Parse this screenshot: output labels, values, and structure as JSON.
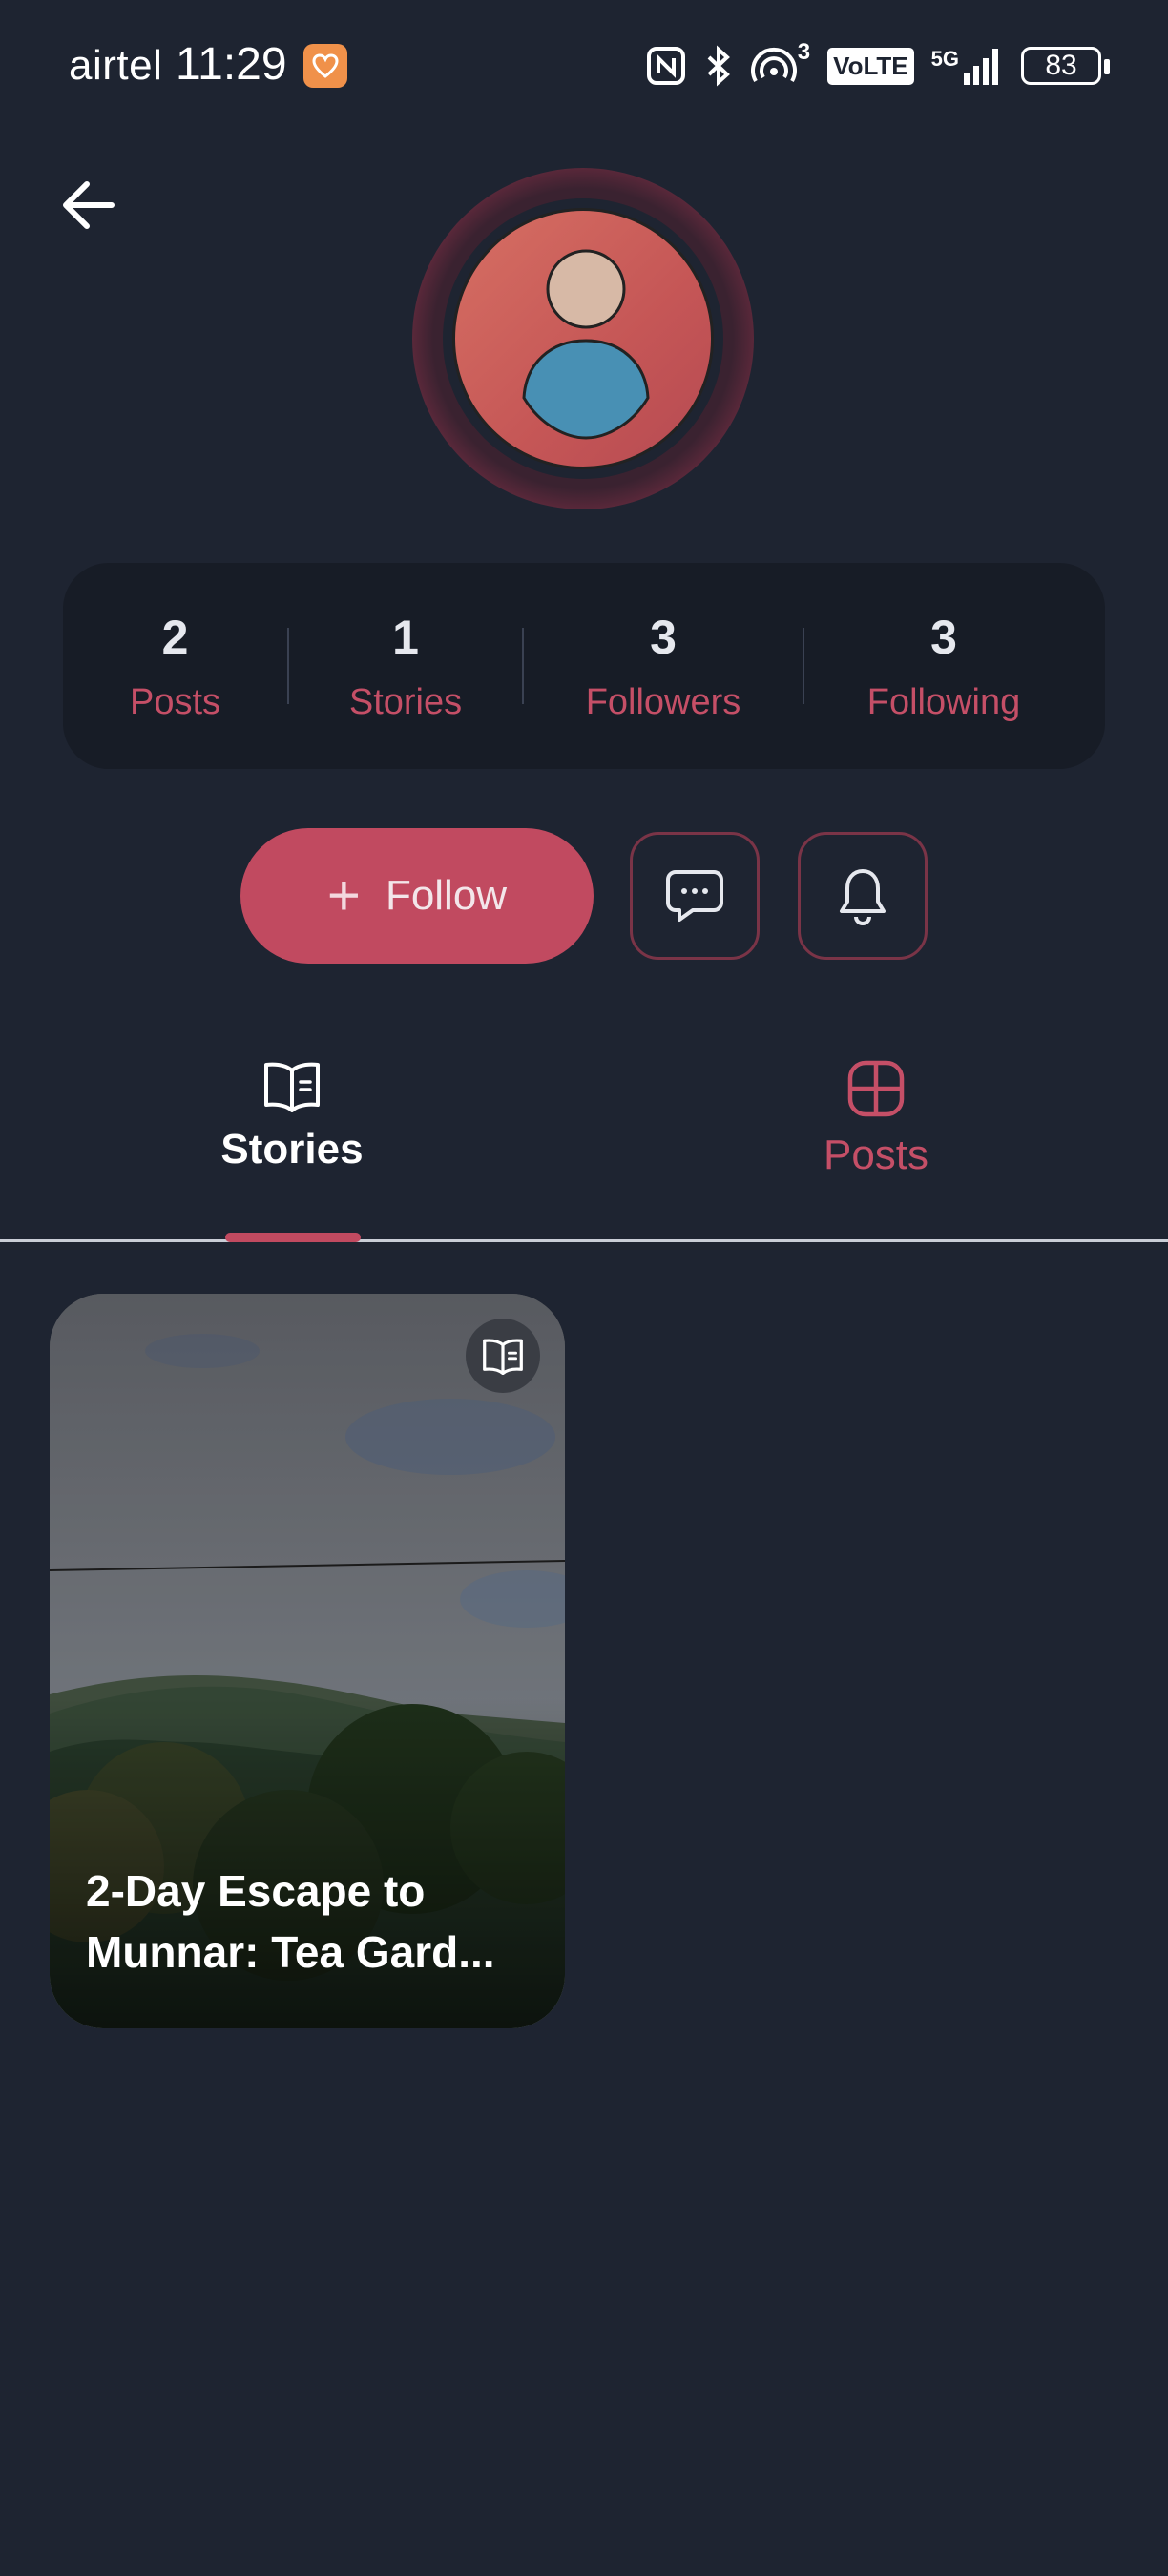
{
  "status_bar": {
    "carrier": "airtel",
    "time": "11:29",
    "network_superscript": "3",
    "volte": "VoLTE",
    "network_type": "5G",
    "battery": "83"
  },
  "profile": {
    "stats": [
      {
        "value": "2",
        "label": "Posts"
      },
      {
        "value": "1",
        "label": "Stories"
      },
      {
        "value": "3",
        "label": "Followers"
      },
      {
        "value": "3",
        "label": "Following"
      }
    ]
  },
  "actions": {
    "follow_plus": "+",
    "follow_label": "Follow"
  },
  "tabs": [
    {
      "label": "Stories",
      "icon": "book-open-icon",
      "active": true
    },
    {
      "label": "Posts",
      "icon": "grid-icon",
      "active": false
    }
  ],
  "stories": [
    {
      "title": "2-Day Escape to Munnar: Tea Gard..."
    }
  ],
  "colors": {
    "background": "#1e2431",
    "accent": "#c14a60",
    "accent_text": "#c54f67",
    "stats_panel": "#171c26"
  }
}
